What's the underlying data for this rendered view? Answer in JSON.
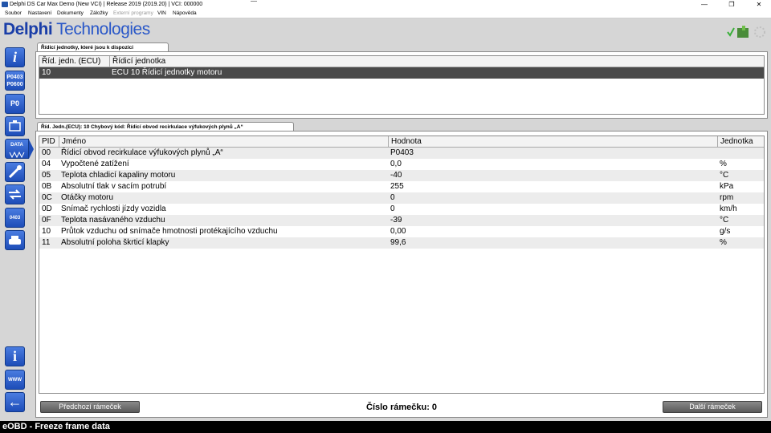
{
  "window": {
    "title": "Delphi DS Car Max Demo (New VCI) | Release 2019 (2019.20) | VCI: 000000",
    "minimize_glyph": "—",
    "maximize_glyph": "❐",
    "close_glyph": "✕"
  },
  "menu": {
    "items": [
      "Soubor",
      "Nastavení",
      "Dokumenty",
      "Záložky",
      "Externí programy",
      "VIN",
      "Nápověda"
    ]
  },
  "logo": {
    "brand": "Delphi",
    "suffix": "Technologies"
  },
  "toolbar": {
    "tools": [
      {
        "icon": "info-icon",
        "label": "i"
      },
      {
        "icon": "dtc-codes-icon",
        "label": "P0403 P0600"
      },
      {
        "icon": "dtc-erase-icon",
        "label": "P0"
      },
      {
        "icon": "engine-icon",
        "label": ""
      },
      {
        "icon": "live-data-icon",
        "label": "DATA"
      },
      {
        "icon": "actuator-icon",
        "label": ""
      },
      {
        "icon": "adjustment-icon",
        "label": ""
      },
      {
        "icon": "code-search-icon",
        "label": "0403"
      },
      {
        "icon": "vehicle-test-icon",
        "label": ""
      },
      {
        "icon": "help-icon",
        "label": "i"
      },
      {
        "icon": "www-icon",
        "label": "WWW"
      },
      {
        "icon": "back-arrow-icon",
        "label": "←"
      }
    ]
  },
  "ecu_panel": {
    "tab": "Řídicí jednotky, které jsou k dispozici",
    "columns": [
      "Říd. jedn. (ECU)",
      "Řídicí jednotka"
    ],
    "rows": [
      {
        "id": "10",
        "name": "ECU 10 Řídicí jednotky motoru"
      }
    ]
  },
  "freeze_panel": {
    "tab": "Říd. Jedn.(ECU): 10 Chybový kód: Řídicí obvod recirkulace výfukových plynů „A“",
    "columns": [
      "PID",
      "Jméno",
      "Hodnota",
      "Jednotka"
    ],
    "rows": [
      {
        "pid": "00",
        "name": "Řídicí obvod recirkulace výfukových plynů „A“",
        "value": "P0403",
        "unit": ""
      },
      {
        "pid": "04",
        "name": "Vypočtené zatížení",
        "value": "0,0",
        "unit": "%"
      },
      {
        "pid": "05",
        "name": "Teplota chladicí kapaliny motoru",
        "value": "-40",
        "unit": "°C"
      },
      {
        "pid": "0B",
        "name": "Absolutní tlak v sacím potrubí",
        "value": "255",
        "unit": "kPa"
      },
      {
        "pid": "0C",
        "name": "Otáčky motoru",
        "value": "0",
        "unit": "rpm"
      },
      {
        "pid": "0D",
        "name": "Snímač rychlosti jízdy vozidla",
        "value": "0",
        "unit": "km/h"
      },
      {
        "pid": "0F",
        "name": "Teplota nasávaného vzduchu",
        "value": "-39",
        "unit": "°C"
      },
      {
        "pid": "10",
        "name": "Průtok vzduchu od snímače hmotnosti protékajícího vzduchu",
        "value": "0,00",
        "unit": "g/s"
      },
      {
        "pid": "11",
        "name": "Absolutní poloha škrticí klapky",
        "value": "99,6",
        "unit": "%"
      }
    ]
  },
  "footer": {
    "prev_button": "Předchozí rámeček",
    "next_button": "Další rámeček",
    "frame_label": "Číslo rámečku: 0"
  },
  "statusbar": {
    "text": "eOBD - Freeze frame data"
  }
}
